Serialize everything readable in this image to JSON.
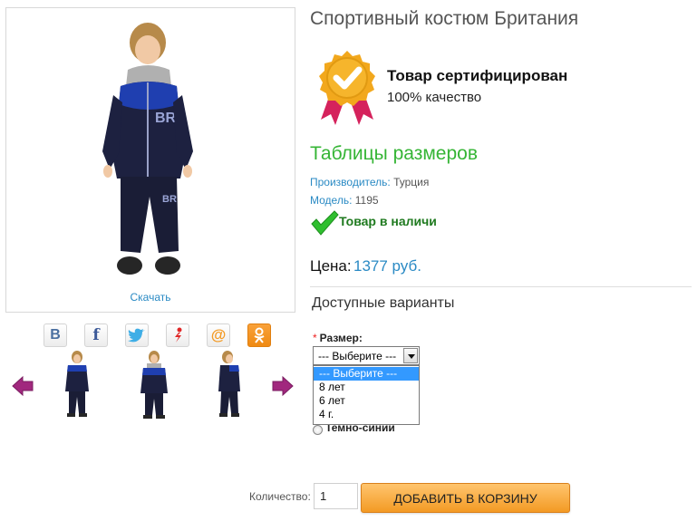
{
  "product": {
    "title": "Спортивный костюм Британия",
    "download_link": "Скачать",
    "certification": {
      "title": "Товар сертифицирован",
      "subtitle": "100% качество"
    },
    "size_tables_link": "Таблицы размеров",
    "manufacturer_label": "Производитель:",
    "manufacturer_value": "Турция",
    "model_label": "Модель:",
    "model_value": "1195",
    "stock_status": "Товар в наличи",
    "price_label": "Цена:",
    "price_value": "1377 руб."
  },
  "social": {
    "buttons": [
      {
        "name": "vk",
        "glyph": "B"
      },
      {
        "name": "facebook",
        "glyph": "f"
      },
      {
        "name": "twitter",
        "glyph": ""
      },
      {
        "name": "moi-krug",
        "glyph": ""
      },
      {
        "name": "mail-ru",
        "glyph": "@"
      },
      {
        "name": "odnoklassniki",
        "glyph": ""
      }
    ]
  },
  "options": {
    "heading": "Доступные варианты",
    "size_label": "Размер:",
    "required_mark": "*",
    "size_selected": "--- Выберите ---",
    "size_options": [
      "--- Выберите ---",
      "8 лет",
      "6 лет",
      "4 г."
    ],
    "color_option_label": "Темно-синий"
  },
  "cart": {
    "qty_label": "Количество:",
    "qty_value": "1",
    "add_to_cart_label": "ДОБАВИТЬ В КОРЗИНУ"
  },
  "colors": {
    "accent_blue": "#2a8ac4",
    "green": "#35b535",
    "cart_orange": "#f39a24",
    "carousel_arrow": "#a1287e",
    "badge_gold": "#f2a81d",
    "badge_ribbon": "#d5225c"
  }
}
